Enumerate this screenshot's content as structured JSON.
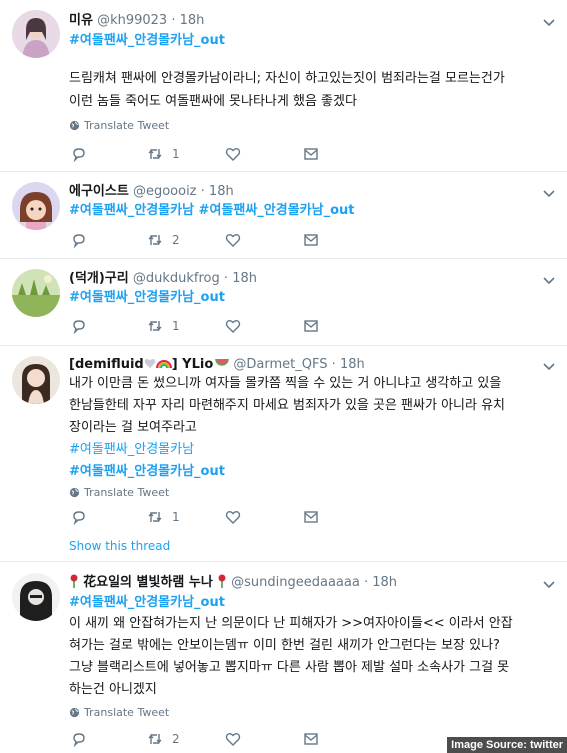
{
  "tweets": [
    {
      "name": "미유",
      "handle": "@kh99023",
      "dot": "·",
      "time": "18h",
      "hashtag": "#여돌팬싸_안경몰카남_out",
      "lines": [
        "드림캐쳐 팬싸에 안경몰카남이라니; 자신이 하고있는짓이 범죄라는걸 모르는건가",
        "이런 놈들 죽어도 여돌팬싸에 못나타나게 했음 좋겠다"
      ],
      "translate": "Translate Tweet",
      "retweets": "1",
      "replies": "",
      "likes": ""
    },
    {
      "name": "에구이스트",
      "handle": "@egoooiz",
      "dot": "·",
      "time": "18h",
      "hashtag": "#여돌팬싸_안경몰카남 #여돌팬싸_안경몰카남_out",
      "retweets": "2"
    },
    {
      "name": "(덕개)구리",
      "handle": "@dukdukfrog",
      "dot": "·",
      "time": "18h",
      "hashtag": "#여돌팬싸_안경몰카남_out",
      "retweets": "1"
    },
    {
      "name": "[demifluid",
      "name_suffix": "] YLio",
      "handle": "@Darmet_QFS",
      "dot": "·",
      "time": "18h",
      "lines": [
        "내가 이만큼 돈 썼으니까 여자들 몰카쯤 찍을 수 있는 거 아니냐고 생각하고 있을",
        "한남들한테 자꾸 자리 마련해주지 마세요 범죄자가 있을 곳은 팬싸가 아니라 유치",
        "장이라는 걸 보여주라고"
      ],
      "hashtag_light": "#여돌팬싸_안경몰카남",
      "hashtag": "#여돌팬싸_안경몰카남_out",
      "translate": "Translate Tweet",
      "retweets": "1",
      "show_thread": "Show this thread"
    },
    {
      "name": "花요일의 별빛하램 누나",
      "handle": "@sundingeedaaaaa",
      "dot": "·",
      "time": "18h",
      "hashtag": "#여돌팬싸_안경몰카남_out",
      "lines": [
        "이 새끼 왜 안잡혀가는지 난 의문이다 난 피해자가  >>여자아이들<< 이라서 안잡",
        "혀가는 걸로 밖에는 안보이는뎀ㅠ 이미 한번 걸린 새끼가 안그런다는 보장 있나?",
        "그냥 블랙리스트에 넣어놓고 뽑지마ㅠ 다른 사람 뽑아 제발 설마 소속사가 그걸 못",
        "하는건 아니겠지"
      ],
      "translate": "Translate Tweet",
      "retweets": "2"
    }
  ],
  "credit": "Image Source: twitter",
  "colors": {
    "link": "#1da1f2",
    "muted": "#657786",
    "text": "#14171a",
    "border": "#e6ecf0"
  }
}
